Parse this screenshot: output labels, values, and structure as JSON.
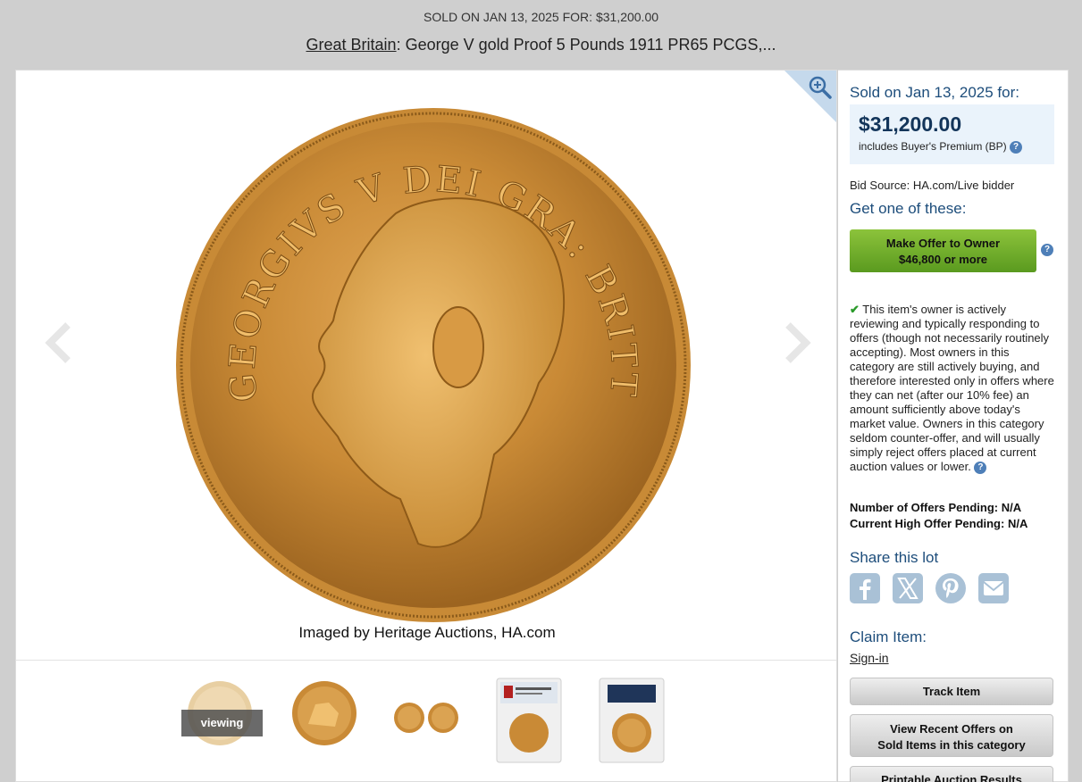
{
  "header": {
    "sold_line": "SOLD ON JAN 13, 2025 FOR: $31,200.00",
    "title_link": "Great Britain",
    "title_rest": ": George V gold Proof 5 Pounds 1911 PR65 PCGS,..."
  },
  "gallery": {
    "caption": "Imaged by Heritage Auctions, HA.com",
    "viewing_label": "viewing",
    "icons": [
      "zoom-in-icon",
      "chevron-left-icon",
      "chevron-right-icon"
    ],
    "thumbnails": [
      "coin-obverse",
      "coin-reverse",
      "coin-pair",
      "pcgs-slab-front",
      "pcgs-slab-back"
    ]
  },
  "sale": {
    "sold_on": "Sold on Jan 13, 2025 for:",
    "price": "$31,200.00",
    "bp_note": "includes Buyer's Premium (BP)",
    "bid_source": "Bid Source: HA.com/Live bidder"
  },
  "offer": {
    "heading": "Get one of these:",
    "button_line1": "Make Offer to Owner",
    "button_line2": "$46,800 or more",
    "owner_text": "This item's owner is actively reviewing and typically responding to offers (though not necessarily routinely accepting). Most owners in this category are still actively buying, and therefore interested only in offers where they can net (after our 10% fee) an amount sufficiently above today's market value. Owners in this category seldom counter-offer, and will usually simply reject offers placed at current auction values or lower.",
    "offers_pending": "Number of Offers Pending: N/A",
    "high_offer": "Current High Offer Pending: N/A"
  },
  "share": {
    "heading": "Share this lot",
    "icons": [
      "facebook-icon",
      "x-icon",
      "pinterest-icon",
      "email-icon"
    ]
  },
  "claim": {
    "heading": "Claim Item:",
    "sign_in": "Sign-in"
  },
  "buttons": {
    "track": "Track Item",
    "recent_line1": "View Recent Offers on",
    "recent_line2": "Sold Items in this category",
    "printable": "Printable Auction Results"
  },
  "colors": {
    "accent_blue": "#1d4d7b",
    "offer_green": "#6aab27",
    "page_bg": "#cfcfcf",
    "coin_gold": "#c98a36"
  }
}
